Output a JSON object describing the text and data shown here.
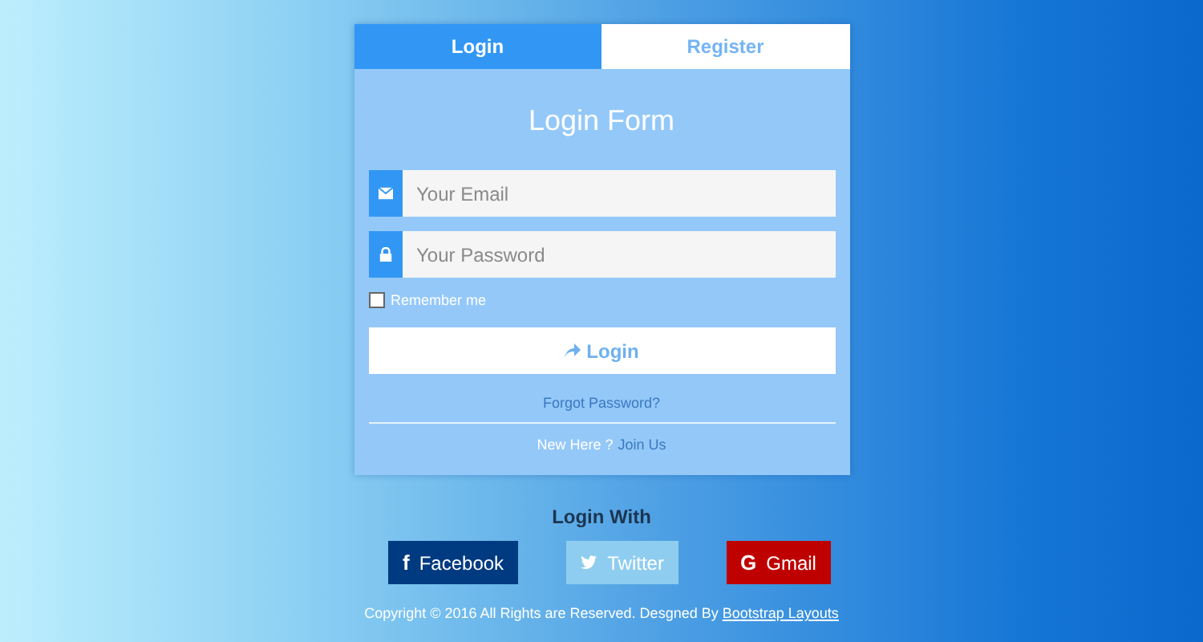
{
  "tabs": [
    {
      "label": "Login",
      "selected": true
    },
    {
      "label": "Register",
      "selected": false
    }
  ],
  "form": {
    "title": "Login Form",
    "fields": [
      {
        "kind": "email",
        "placeholder": "Your Email"
      },
      {
        "kind": "password",
        "placeholder": "Your Password"
      }
    ],
    "remember": {
      "label": "Remember me",
      "checked": false
    },
    "submit": "Login",
    "forgot": "Forgot Password?",
    "signup_prompt": "New Here ?",
    "signup_link": "Join Us"
  },
  "social": {
    "heading": "Login With",
    "buttons": [
      {
        "kind": "facebook",
        "icon": "f",
        "label": "Facebook",
        "color": "#003a80"
      },
      {
        "kind": "twitter",
        "label": "Twitter",
        "color": "#8ecdef"
      },
      {
        "kind": "gmail",
        "icon": "G",
        "label": "Gmail",
        "color": "#bf0000"
      }
    ]
  },
  "footer": {
    "text": "Copyright © 2016 All Rights are Reserved. Desgned By",
    "link": "Bootstrap Layouts"
  }
}
